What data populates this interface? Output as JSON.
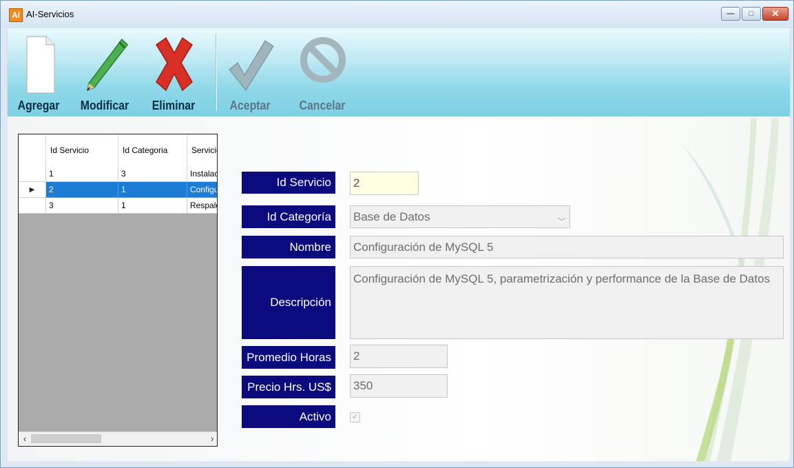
{
  "window": {
    "title": "AI-Servicios",
    "icon_letter": "AI",
    "min_glyph": "—",
    "max_glyph": "□",
    "close_glyph": "✕"
  },
  "toolbar": {
    "buttons": [
      {
        "label": "Agregar",
        "icon": "new-document-icon"
      },
      {
        "label": "Modificar",
        "icon": "pencil-icon"
      },
      {
        "label": "Eliminar",
        "icon": "red-x-icon"
      },
      {
        "label": "Aceptar",
        "icon": "checkmark-icon",
        "disabled": true
      },
      {
        "label": "Cancelar",
        "icon": "cancel-icon",
        "disabled": true
      }
    ]
  },
  "grid": {
    "columns": [
      "Id Servicio",
      "Id Categoria",
      "Servicio"
    ],
    "rows": [
      {
        "id": "1",
        "categoria": "3",
        "servicio": "Instalación"
      },
      {
        "id": "2",
        "categoria": "1",
        "servicio": "Configuración"
      },
      {
        "id": "3",
        "categoria": "1",
        "servicio": "Respaldo"
      }
    ],
    "selected_row": 1,
    "row_indicator": "▶",
    "scroll_left": "‹",
    "scroll_right": "›"
  },
  "form": {
    "id_servicio": {
      "label": "Id Servicio",
      "value": "2"
    },
    "id_categoria": {
      "label": "Id Categoría",
      "value": "Base de Datos"
    },
    "nombre": {
      "label": "Nombre",
      "value": "Configuración de MySQL 5"
    },
    "descripcion": {
      "label": "Descripción",
      "value": "Configuración de MySQL 5, parametrización y performance de la Base de Datos"
    },
    "promedio_horas": {
      "label": "Promedio Horas",
      "value": "2"
    },
    "precio": {
      "label": "Precio Hrs. US$",
      "value": "350"
    },
    "activo": {
      "label": "Activo",
      "checked": true,
      "check_glyph": "✓"
    }
  },
  "colors": {
    "label_bg": "#0b0b7e",
    "selection": "#1e7bd6",
    "toolbar": "#8dd7e9"
  }
}
